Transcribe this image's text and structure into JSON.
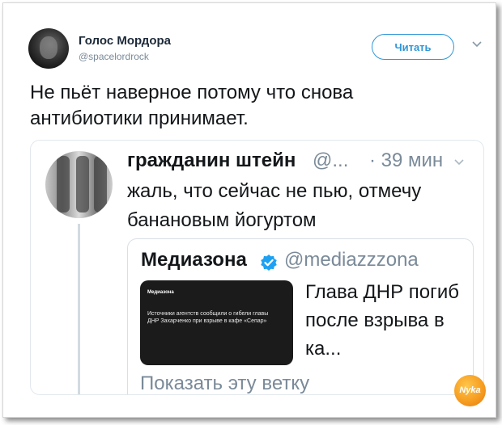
{
  "tweet": {
    "author_name": "Голос Мордора",
    "author_handle": "@spacelordrock",
    "follow_label": "Читать",
    "text": "Не пьёт наверное потому что снова антибиотики принимает."
  },
  "quoted_tweet": {
    "author_name": "гражданин штейн",
    "author_handle": "@...",
    "time": "· 39 мин",
    "text": "жаль, что сейчас не пью, отмечу банановым йогуртом",
    "show_thread_label": "Показать эту ветку"
  },
  "card": {
    "author_name": "Медиазона",
    "author_handle": "@mediazzzona",
    "headline": "Глава ДНР погиб после взрыва в ка...",
    "thumbnail_label": "Медиазона",
    "thumbnail_text": "Источники агентств сообщили о гибели главы ДНР Захарченко при взрыве в кафе «Сепар»"
  },
  "watermark": {
    "text": "Nyka"
  },
  "colors": {
    "accent": "#2f96d8",
    "text": "#14171a",
    "secondary": "#7a8a99",
    "border": "#e1e8ed",
    "logo": "#f59a1e"
  },
  "icons": [
    "chevron-down-icon",
    "verified-badge-icon"
  ]
}
